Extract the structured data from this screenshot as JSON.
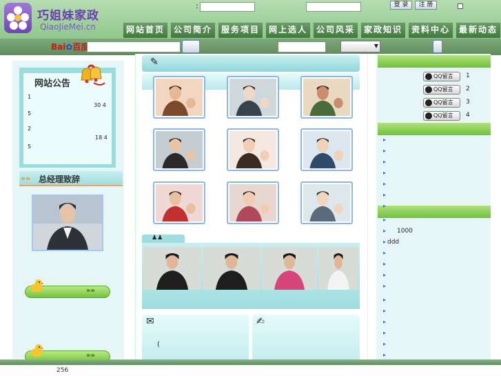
{
  "brand": {
    "name_cn": "巧姐妹家政",
    "name_en": "QiaoJieMei.cn"
  },
  "header": {
    "login_colon": ":",
    "login_button": "登 录",
    "register_button": "注 册"
  },
  "nav": [
    "网站首页",
    "公司简介",
    "服务项目",
    "网上选人",
    "公司风采",
    "家政知识",
    "资料中心",
    "最新动态"
  ],
  "search": {
    "baidu_prefix": "Bai",
    "baidu_suffix": "百度"
  },
  "notice": {
    "title": "网站公告",
    "line1": "1",
    "line1_value": "30 4",
    "line2": "5",
    "line3": "2",
    "line3_value": "18 4",
    "line4": "5"
  },
  "gm": {
    "title": "总经理致辞"
  },
  "center": {
    "paren": "(",
    "thumbs": [
      "photo-mother-baby",
      "photo-nanny-infant",
      "photo-elder-care",
      "photo-professional",
      "photo-baby-cuddle",
      "photo-family",
      "photo-cleaning",
      "photo-group",
      "photo-senior-help"
    ],
    "videos": [
      "video-1",
      "video-2",
      "video-3",
      "video-4"
    ]
  },
  "right": {
    "qq": [
      {
        "label": "QQ留言",
        "num": "1"
      },
      {
        "label": "QQ留言",
        "num": "2"
      },
      {
        "label": "QQ留言",
        "num": "3"
      },
      {
        "label": "QQ留言",
        "num": "4"
      }
    ],
    "value_1000": "1000",
    "value_ddd": "ddd"
  },
  "footer": {
    "counter": "256"
  },
  "colors": {
    "nav_green": "#3f7a3c",
    "brand_purple": "#6a3fb0",
    "accent_teal": "#9fdde0"
  }
}
